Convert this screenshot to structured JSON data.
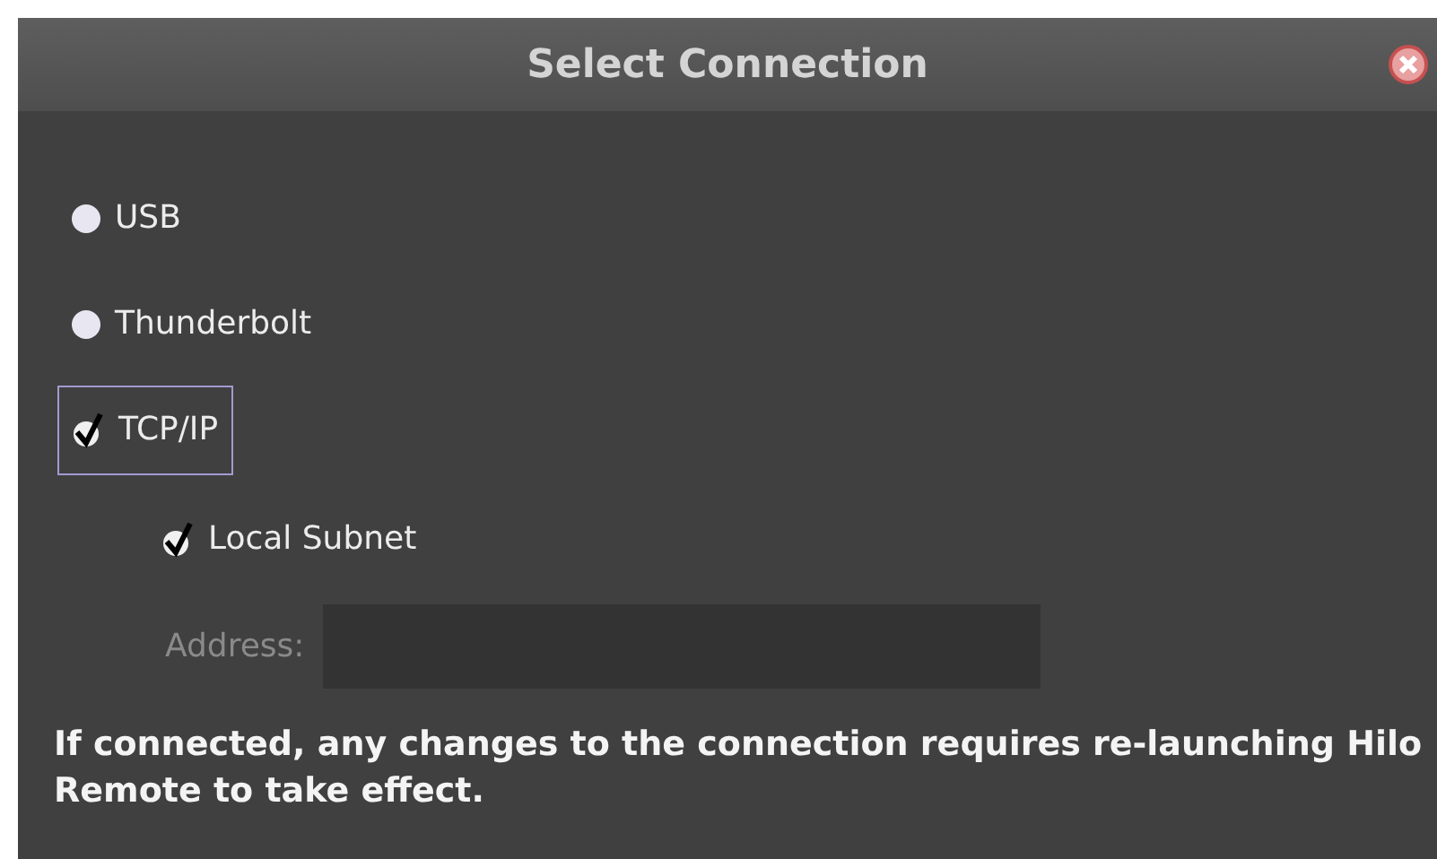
{
  "window": {
    "title": "Select Connection"
  },
  "connection_options": [
    {
      "label": "USB",
      "selected": false,
      "focused": false
    },
    {
      "label": "Thunderbolt",
      "selected": false,
      "focused": false
    },
    {
      "label": "TCP/IP",
      "selected": true,
      "focused": true
    }
  ],
  "local_subnet": {
    "label": "Local Subnet",
    "checked": true
  },
  "address": {
    "label": "Address:",
    "disabled": true
  },
  "note": "If connected, any changes to the connection requires re-launching Hilo Remote to take effect."
}
